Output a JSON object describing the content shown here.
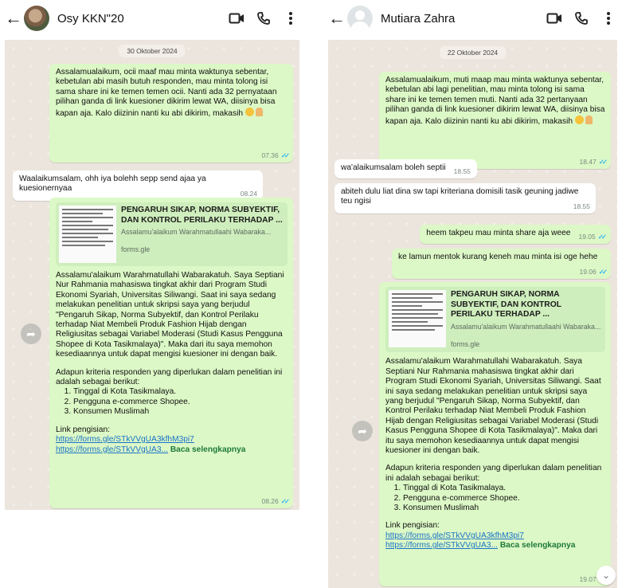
{
  "left": {
    "contact_name": "Osy KKN\"20",
    "date": "30 Oktober 2024",
    "msg1": {
      "text": "Assalamualaikum, ocii maaf mau minta waktunya sebentar, kebetulan abi masih butuh responden, mau minta tolong isi sama share ini ke temen temen ocii. Nanti ada 32 pernyataan pilihan ganda di link kuesioner dikirim lewat WA, diisinya bisa kapan aja. Kalo diizinin nanti ku abi dikirim, makasih",
      "time": "07.36"
    },
    "msg2": {
      "text": "Waalaikumsalam, ohh iya bolehh sepp send ajaa ya kuesionernyaa",
      "time": "08.24"
    },
    "form_msg": {
      "time": "08.26"
    }
  },
  "right": {
    "contact_name": "Mutiara Zahra",
    "date": "22 Oktober 2024",
    "msg1": {
      "text": "Assalamualaikum, muti maap mau minta waktunya sebentar, kebetulan abi lagi penelitian, mau minta tolong isi sama share ini ke temen temen muti. Nanti ada 32 pertanyaan pilihan ganda di link kuesioner dikirim lewat WA, diisinya bisa kapan aja. Kalo diizinin nanti ku abi dikirim, makasih",
      "time": "18.47"
    },
    "msg2": {
      "text": "wa'alaikumsalam boleh septii",
      "time": "18.55"
    },
    "msg3": {
      "text": "abiteh dulu liat dina sw tapi kriteriana domisili tasik geuning jadiwe teu ngisi",
      "time": "18.55"
    },
    "msg4": {
      "text": "heem takpeu mau minta share aja weee",
      "time": "19.05"
    },
    "msg5": {
      "text": "ke lamun mentok kurang keneh mau minta isi oge hehe",
      "time": "19.06"
    },
    "form_msg": {
      "time": "19.07"
    }
  },
  "form": {
    "preview_title": "PENGARUH SIKAP, NORMA SUBYEKTIF, DAN KONTROL PERILAKU TERHADAP ...",
    "preview_desc": "Assalamu'alaikum Warahmatullaahi Wabaraka...",
    "preview_domain": "forms.gle",
    "intro": "Assalamu'alaikum Warahmatullahi Wabarakatuh. Saya Septiani Nur Rahmania mahasiswa tingkat akhir dari Program Studi Ekonomi Syariah, Universitas Siliwangi. Saat ini saya sedang melakukan penelitian untuk skripsi saya yang berjudul \"Pengaruh Sikap, Norma Subyektif, dan Kontrol Perilaku terhadap Niat Membeli Produk Fashion Hijab dengan Religiusitas sebagai Variabel Moderasi (Studi Kasus Pengguna Shopee di Kota Tasikmalaya)\". Maka dari itu saya memohon kesediaannya untuk dapat mengisi kuesioner ini dengan baik.",
    "criteria_intro": "Adapun kriteria responden yang diperlukan dalam penelitian ini adalah sebagai berikut:",
    "criteria": [
      "Tinggal di Kota Tasikmalaya.",
      "Pengguna e-commerce Shopee.",
      "Konsumen Muslimah"
    ],
    "link_label": "Link pengisian:",
    "link1": "https://forms.gle/STkVVgUA3kfhM3pi7",
    "link2": "https://forms.gle/STkVVgUA3...",
    "read_more": "Baca selengkapnya"
  },
  "icons": [
    "back-arrow-icon",
    "video-call-icon",
    "voice-call-icon",
    "more-vertical-icon",
    "forward-icon",
    "scroll-down-icon"
  ],
  "colors": {
    "outgoing_bubble": "#dcf8c6",
    "incoming_bubble": "#ffffff",
    "chat_bg": "#ece5dd",
    "read_ticks": "#34b7f1",
    "link": "#1a73c8"
  }
}
